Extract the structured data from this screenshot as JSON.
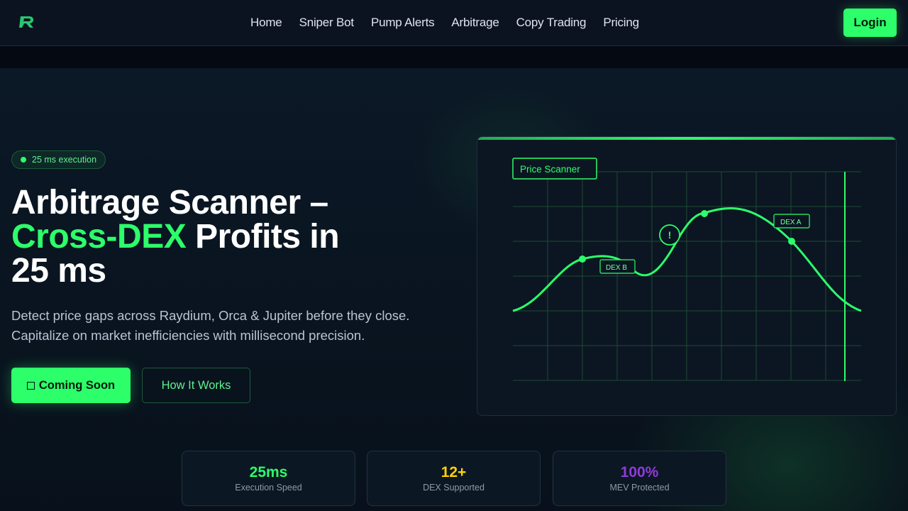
{
  "nav": {
    "links": [
      "Home",
      "Sniper Bot",
      "Pump Alerts",
      "Arbitrage",
      "Copy Trading",
      "Pricing"
    ],
    "login": "Login"
  },
  "hero": {
    "badge": "25 ms execution",
    "headline_line1": "Arbitrage Scanner –",
    "headline_accent": "Cross-DEX",
    "headline_rest": " Profits in",
    "headline_line3": "25 ms",
    "subtext_line1": "Detect price gaps across Raydium, Orca & Jupiter before they close.",
    "subtext_line2": "Capitalize on market inefficiencies with millisecond precision.",
    "primary_button": "Coming Soon",
    "secondary_button": "How It Works"
  },
  "scanner": {
    "title": "Price Scanner",
    "label_dex_b": "DEX B",
    "label_dex_a": "DEX A",
    "alert_symbol": "!"
  },
  "stats": [
    {
      "value": "25ms",
      "label": "Execution Speed",
      "color": "#2cff6a"
    },
    {
      "value": "12+",
      "label": "DEX Supported",
      "color": "#ffd400"
    },
    {
      "value": "100%",
      "label": "MEV Protected",
      "color": "#8e3bd8"
    }
  ],
  "colors": {
    "accent": "#2cff6a",
    "background": "#0a111c"
  }
}
